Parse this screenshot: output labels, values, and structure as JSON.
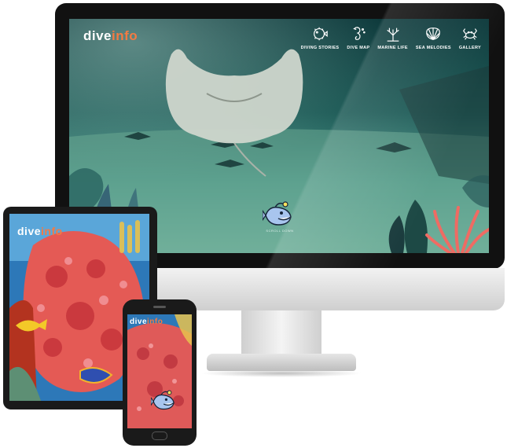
{
  "brand": {
    "logo_part1": "dive",
    "logo_part2": "info",
    "accent_color": "#f47a42"
  },
  "nav": [
    {
      "label": "DIVING STORIES",
      "icon": "pufferfish-icon"
    },
    {
      "label": "DIVE MAP",
      "icon": "seahorse-icon"
    },
    {
      "label": "MARINE LIFE",
      "icon": "coral-icon"
    },
    {
      "label": "SEA MELODIES",
      "icon": "seashell-icon"
    },
    {
      "label": "GALLERY",
      "icon": "crab-icon"
    }
  ],
  "hero": {
    "mascot": "anglerfish-icon",
    "caption": "SCROLL DOWN"
  },
  "devices": [
    "desktop-monitor",
    "tablet",
    "smartphone"
  ]
}
